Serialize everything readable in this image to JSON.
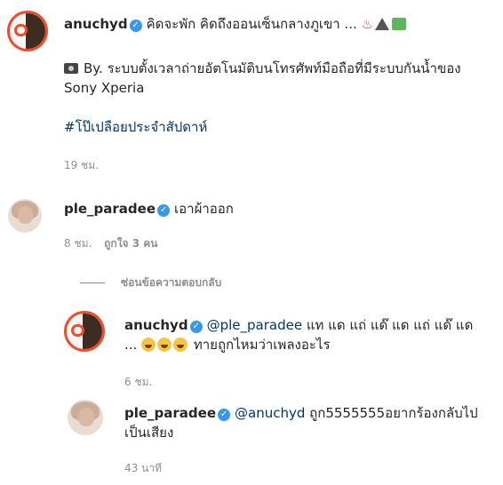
{
  "post": {
    "username": "anuchyd",
    "caption_line1": "คิดจะพัก คิดถึงออนเซ็นกลางภูเขา ...",
    "caption_line2_prefix": "By. ระบบตั้งเวลาถ่ายอัตโนมัติบนโทรศัพท์มือถือที่มีระบบกันน้ำของ",
    "caption_line3": "Sony Xperia",
    "hashtag": "#โป๊เปลือยประจำสัปดาห์",
    "time": "19 ชม.",
    "icons": [
      "hot-springs-icon",
      "mountain-icon",
      "national-park-icon",
      "camera-icon"
    ]
  },
  "comment": {
    "username": "ple_paradee",
    "text": "เอาผ้าออก",
    "time": "8 ชม.",
    "likes": "ถูกใจ 3 คน",
    "hide_replies": "ซ่อนข้อความตอบกลับ"
  },
  "replies": [
    {
      "username": "anuchyd",
      "mention": "@ple_paradee",
      "text_line1": "แท แด แถ่ แด๊ แด แถ่ แด๊ แด",
      "text_line2_prefix": "...",
      "text_line2_suffix": "ทายถูกไหมว่าเพลงอะไร",
      "time": "6 ชม."
    },
    {
      "username": "ple_paradee",
      "mention": "@anuchyd",
      "text_line1": "ถูก5555555อยากร้องกลับไป",
      "text_line2": "เป็นเสียง",
      "time": "43 นาที"
    }
  ],
  "colors": {
    "link": "#00376b",
    "verified": "#3897f0",
    "meta": "#8e8e8e"
  }
}
